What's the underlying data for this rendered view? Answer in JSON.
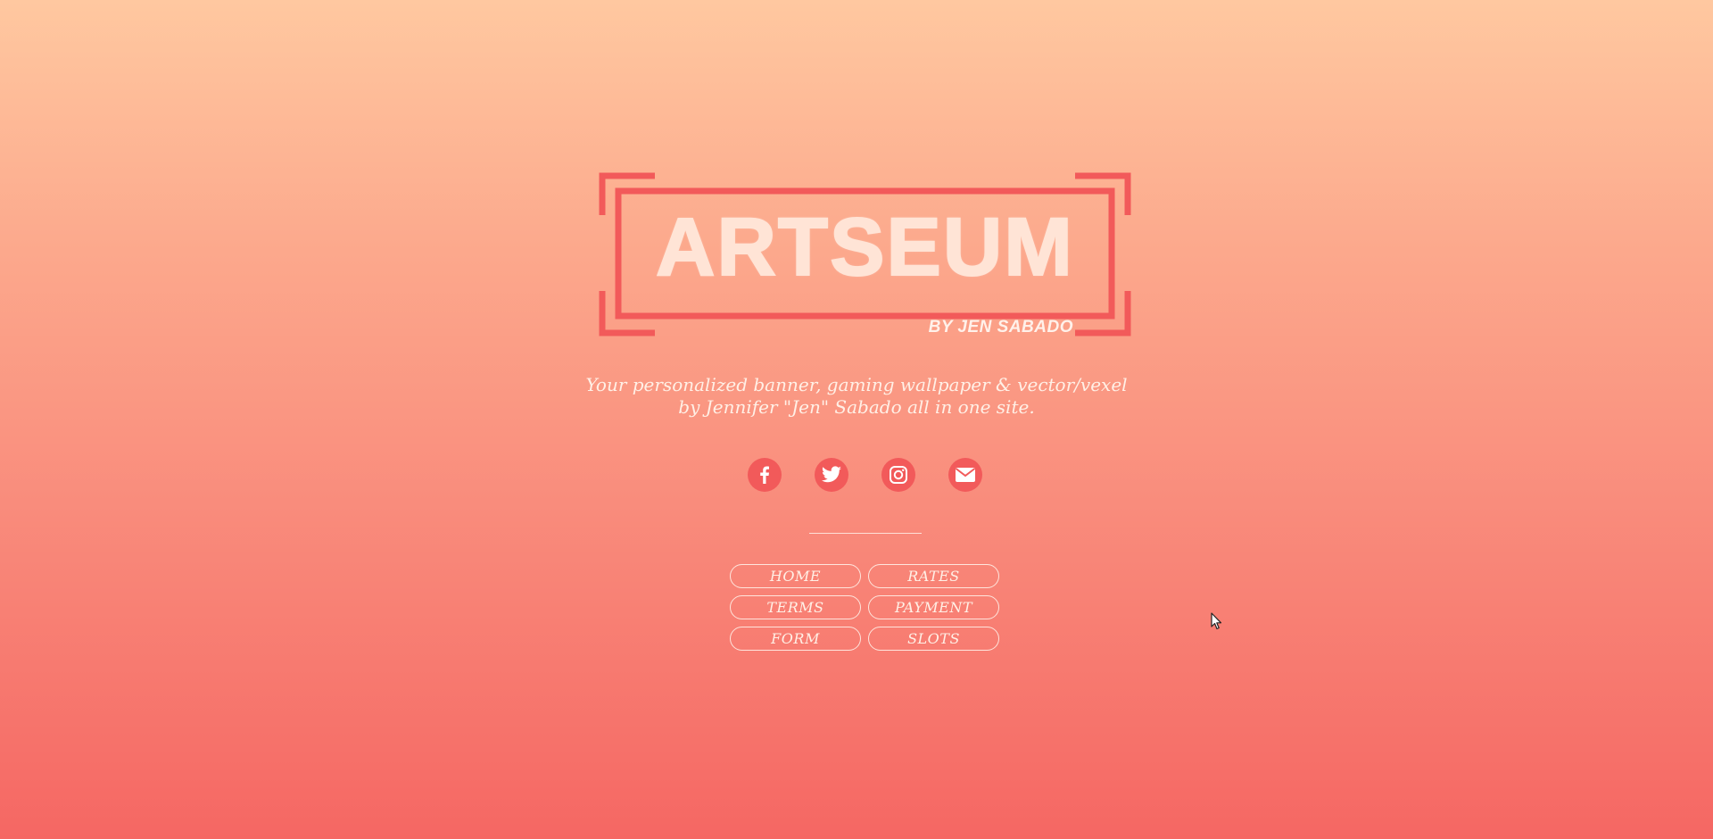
{
  "logo": {
    "title": "ARTSEUM",
    "subtitle": "BY JEN SABADO"
  },
  "tagline": {
    "line1": "Your personalized banner, gaming wallpaper & vector/vexel",
    "line2": "by Jennifer \"Jen\" Sabado all in one site."
  },
  "social": [
    {
      "icon": "facebook-icon"
    },
    {
      "icon": "twitter-icon"
    },
    {
      "icon": "instagram-icon"
    },
    {
      "icon": "email-icon"
    }
  ],
  "nav": {
    "home": "HOME",
    "rates": "RATES",
    "terms": "TERMS",
    "payment": "PAYMENT",
    "form": "FORM",
    "slots": "SLOTS"
  },
  "colors": {
    "accent": "#f25a5a",
    "text_light": "#fff0e6",
    "gradient_top": "#ffc8a0",
    "gradient_bottom": "#f56763"
  }
}
